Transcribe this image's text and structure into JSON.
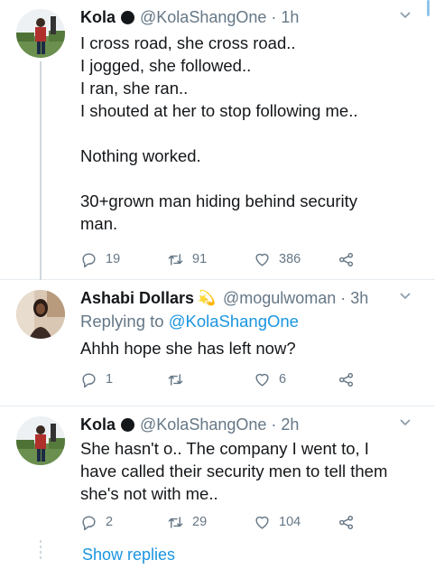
{
  "tweets": [
    {
      "name": "Kola",
      "handle": "@KolaShangOne",
      "time": "· 1h",
      "body": "I cross road, she cross road..\nI jogged, she followed..\nI ran, she ran..\nI shouted at her to stop following me..\n\nNothing worked.\n\n30+grown man hiding behind security\nman.",
      "reply_count": "19",
      "retweet_count": "91",
      "like_count": "386"
    },
    {
      "name": "Ashabi Dollars",
      "emoji": "💫",
      "handle": "@mogulwoman",
      "time": "· 3h",
      "replying_label": "Replying to",
      "replying_mention": "@KolaShangOne",
      "body": "Ahhh hope she has left now?",
      "reply_count": "1",
      "retweet_count": "",
      "like_count": "6"
    },
    {
      "name": "Kola",
      "handle": "@KolaShangOne",
      "time": "· 2h",
      "body": "She hasn't o.. The company I went to, I\nhave called their security men to tell them\nshe's not with me..",
      "reply_count": "2",
      "retweet_count": "29",
      "like_count": "104"
    }
  ],
  "show_replies": "Show replies",
  "colors": {
    "link": "#1b95e0",
    "secondary": "#657786",
    "text": "#14171a",
    "divider": "#e6ecf0"
  },
  "icons": [
    "reply-icon",
    "retweet-icon",
    "like-icon",
    "share-icon",
    "chevron-down-icon",
    "verified-dot"
  ]
}
